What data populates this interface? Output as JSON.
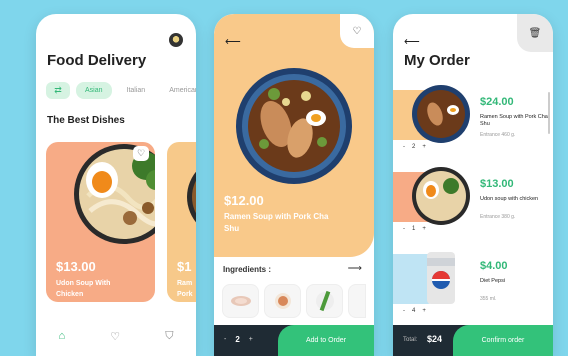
{
  "home": {
    "title": "Food Delivery",
    "filter_icon": "sliders-icon",
    "categories": [
      "Asian",
      "Italian",
      "American"
    ],
    "section_title": "The Best Dishes",
    "featured": {
      "price": "$13.00",
      "name": "Udon Soup With Chicken"
    },
    "next_card": {
      "price": "$1",
      "name_line1": "Ram",
      "name_line2": "Pork"
    },
    "nav": [
      "home-icon",
      "heart-icon",
      "bag-icon"
    ]
  },
  "detail": {
    "price": "$12.00",
    "name": "Ramen Soup with Pork Cha Shu",
    "ingredients_label": "Ingredients :",
    "quantity": "2",
    "minus": "-",
    "plus": "+",
    "add_label": "Add to Order"
  },
  "order": {
    "title": "My Order",
    "items": [
      {
        "price": "$24.00",
        "name": "Ramen Soup with Pork Cha Shu",
        "amount": "Entrance 460 g.",
        "qty": "2",
        "bg": "#f9c98a"
      },
      {
        "price": "$13.00",
        "name": "Udon soup with chicken",
        "amount": "Entrance 380 g.",
        "qty": "1",
        "bg": "#f7ab86"
      },
      {
        "price": "$4.00",
        "name": "Diet Pepsi",
        "amount": "355 ml.",
        "qty": "4",
        "bg": "#bfe4f4"
      }
    ],
    "total_label": "Total:",
    "total_value": "$24",
    "confirm_label": "Confirm order"
  },
  "colors": {
    "accent": "#33c27a",
    "dark": "#1f2b34",
    "peach": "#f7ab86",
    "orange": "#f9c98a",
    "background": "#7fd6ec"
  }
}
